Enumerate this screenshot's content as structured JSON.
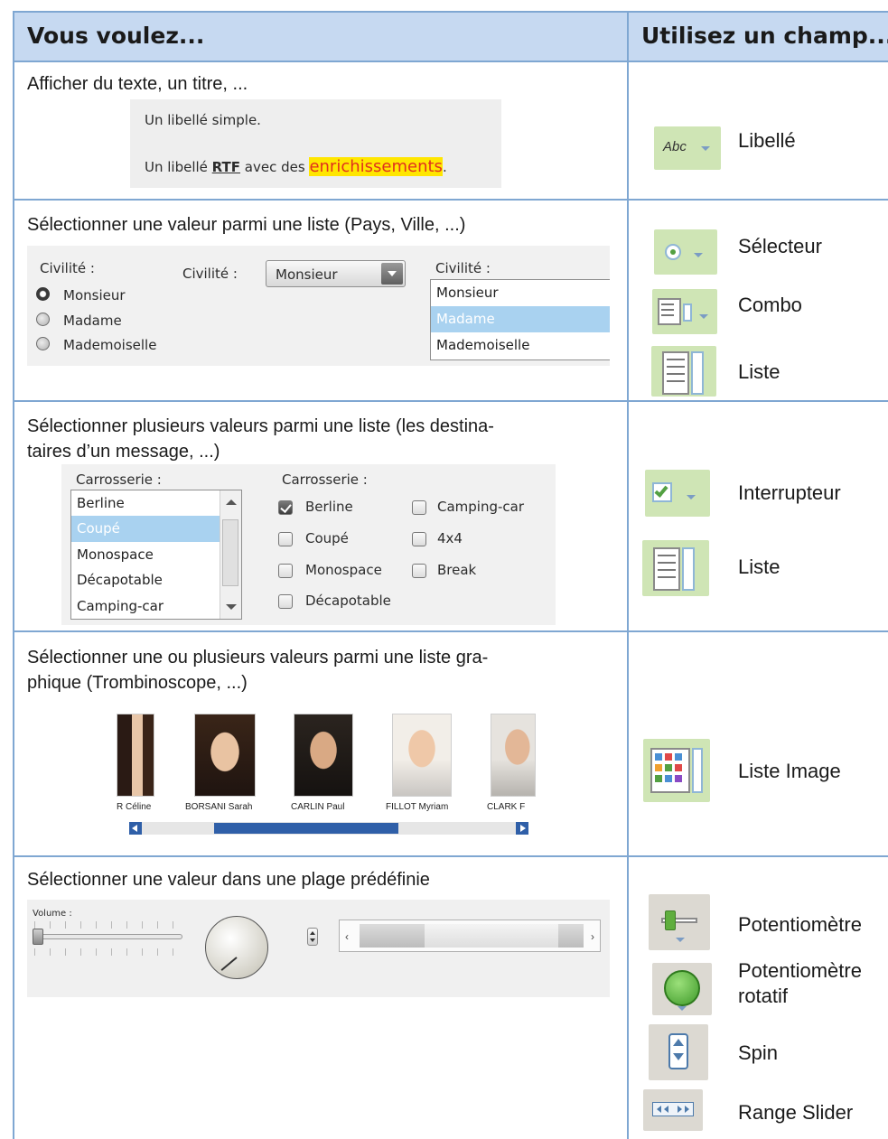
{
  "header": {
    "col1": "Vous voulez...",
    "col2": "Utilisez un champ..."
  },
  "rows": [
    {
      "description": "Afficher du texte, un titre, ...",
      "preview": {
        "line1": "Un libellé simple.",
        "line2_prefix": "Un libellé ",
        "line2_rtf": "RTF",
        "line2_mid": " avec des ",
        "line2_highlight": "enrichissements",
        "line2_suffix": "."
      },
      "fields": [
        {
          "icon": "abc-label-icon",
          "icon_text": "Abc",
          "label": "Libellé"
        }
      ]
    },
    {
      "description": "Sélectionner une valeur parmi une liste (Pays, Ville, ...)",
      "preview": {
        "radio_caption": "Civilité :",
        "radio_options": [
          "Monsieur",
          "Madame",
          "Mademoiselle"
        ],
        "combo_caption": "Civilité :",
        "combo_value": "Monsieur",
        "list_caption": "Civilité :",
        "list_items": [
          "Monsieur",
          "Madame",
          "Mademoiselle"
        ]
      },
      "fields": [
        {
          "icon": "radio-selector-icon",
          "label": "Sélecteur"
        },
        {
          "icon": "combo-icon",
          "label": "Combo"
        },
        {
          "icon": "list-icon",
          "label": "Liste"
        }
      ]
    },
    {
      "description_line1": "Sélectionner plusieurs valeurs parmi une liste (les destina-",
      "description_line2": "taires d’un message, ...)",
      "preview": {
        "list_caption": "Carrosserie :",
        "list_items": [
          "Berline",
          "Coupé",
          "Monospace",
          "Décapotable",
          "Camping-car"
        ],
        "check_caption": "Carrosserie :",
        "check_col1": [
          "Berline",
          "Coupé",
          "Monospace",
          "Décapotable"
        ],
        "check_col2": [
          "Camping-car",
          "4x4",
          "Break"
        ]
      },
      "fields": [
        {
          "icon": "checkbox-switch-icon",
          "label": "Interrupteur"
        },
        {
          "icon": "list-icon",
          "label": "Liste"
        }
      ]
    },
    {
      "description_line1": "Sélectionner une ou plusieurs valeurs parmi une liste gra-",
      "description_line2": "phique (Trombinoscope, ...)",
      "preview": {
        "names": [
          "R Céline",
          "BORSANI Sarah",
          "CARLIN Paul",
          "FILLOT Myriam",
          "CLARK F"
        ]
      },
      "fields": [
        {
          "icon": "image-list-icon",
          "label": "Liste Image"
        }
      ]
    },
    {
      "description": "Sélectionner une valeur dans une plage prédéfinie",
      "preview": {
        "slider_caption": "Volume :"
      },
      "fields": [
        {
          "icon": "slider-icon",
          "label": "Potentiomètre"
        },
        {
          "icon": "rotary-knob-icon",
          "label_line1": "Potentiomètre",
          "label_line2": "rotatif"
        },
        {
          "icon": "spin-icon",
          "label": "Spin"
        },
        {
          "icon": "range-slider-icon",
          "label": "Range Slider"
        }
      ]
    }
  ],
  "colors": {
    "header_bg": "#c6d9f1",
    "grid_line": "#7fa7d2",
    "highlight_bg": "#ffe600",
    "highlight_text": "#e0301e",
    "selection_bg": "#a9d2f0",
    "icon_green": "#cfe5b5"
  }
}
